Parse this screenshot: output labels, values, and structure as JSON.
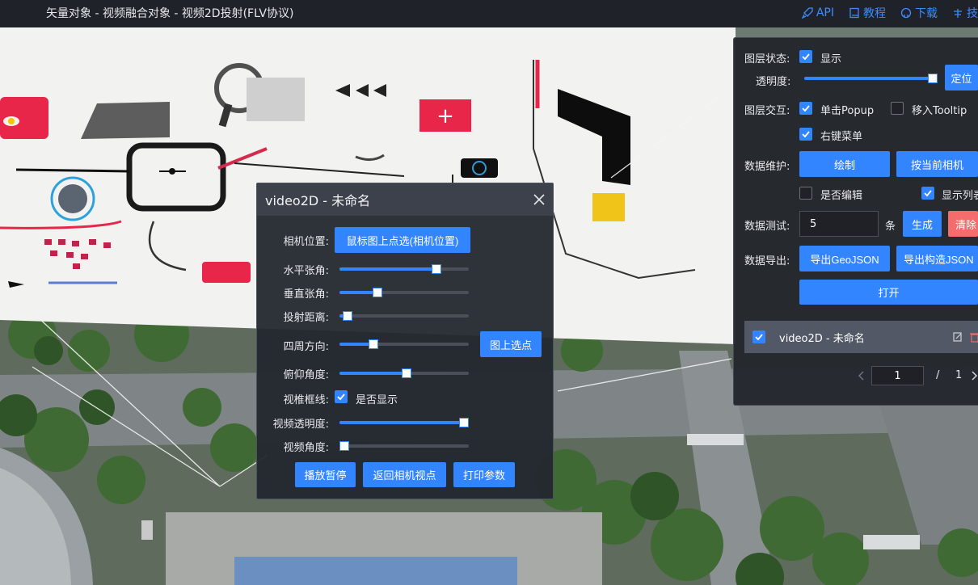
{
  "topbar": {
    "title": "矢量对象 - 视频融合对象 - 视频2D投射(FLV协议)",
    "nav": {
      "api": "API",
      "tutorial": "教程",
      "download": "下载",
      "tech": "技"
    }
  },
  "video2d": {
    "title": "video2D - 未命名",
    "camera_label": "相机位置:",
    "camera_button": "鼠标图上点选(相机位置)",
    "sliders": [
      {
        "label": "水平张角:",
        "value": 0.77
      },
      {
        "label": "垂直张角:",
        "value": 0.28
      },
      {
        "label": "投射距离:",
        "value": 0.03
      },
      {
        "label": "四周方向:",
        "value": 0.24
      },
      {
        "label": "俯仰角度:",
        "value": 0.52
      },
      {
        "label": "视频透明度:",
        "value": 1.0
      },
      {
        "label": "视频角度:",
        "value": 0.0
      }
    ],
    "pick_button": "图上选点",
    "frustum_label": "视椎框线:",
    "frustum_check": "是否显示",
    "buttons": {
      "play": "播放暂停",
      "back": "返回相机视点",
      "print": "打印参数"
    }
  },
  "side": {
    "layer_state_label": "图层状态:",
    "show_label": "显示",
    "opacity_label": "透明度:",
    "opacity_value": 1.0,
    "locate_button": "定位",
    "interact_label": "图层交互:",
    "click_popup": "单击Popup",
    "hover_tooltip": "移入Tooltip",
    "right_menu": "右键菜单",
    "maintain_label": "数据维护:",
    "draw_button": "绘制",
    "by_camera_button": "按当前相机",
    "edit_label": "是否编辑",
    "show_list_label": "显示列表",
    "test_label": "数据测试:",
    "test_value": "5",
    "unit": "条",
    "generate_button": "生成",
    "clear_button": "清除",
    "export_label": "数据导出:",
    "export_geojson": "导出GeoJSON",
    "export_construct": "导出构造JSON",
    "open_button": "打开",
    "list_item": "video2D - 未命名",
    "page_current": "1",
    "page_sep": "/",
    "page_total": "1"
  },
  "colors": {
    "accent": "#3385ff",
    "danger": "#f56c6c",
    "panel": "#23272e"
  }
}
